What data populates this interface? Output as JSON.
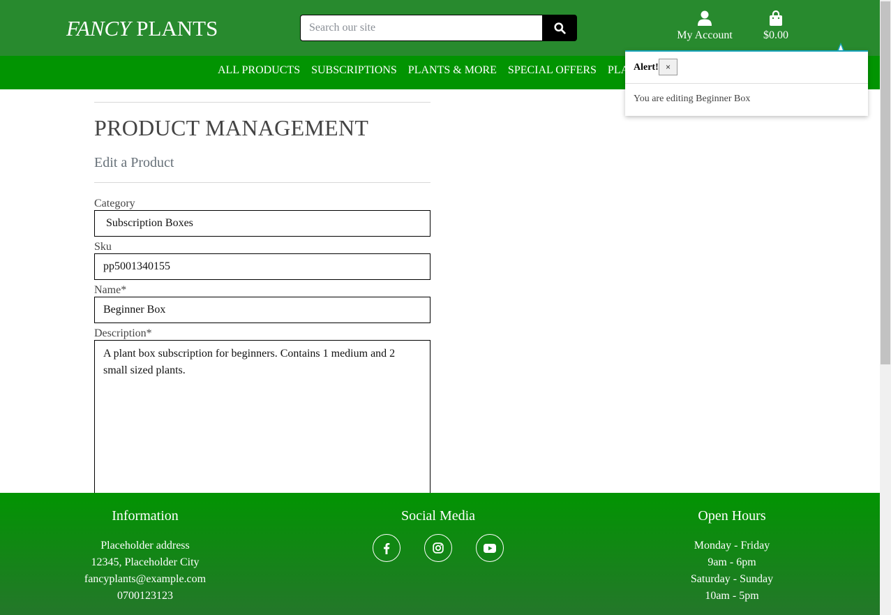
{
  "header": {
    "brand_italic": "FANCY",
    "brand_rest": "PLANTS",
    "search_placeholder": "Search our site",
    "account_label": "My Account",
    "bag_total": "$0.00"
  },
  "nav": {
    "items": [
      "ALL PRODUCTS",
      "SUBSCRIPTIONS",
      "PLANTS & MORE",
      "SPECIAL OFFERS",
      "PLA"
    ]
  },
  "main": {
    "title": "PRODUCT MANAGEMENT",
    "subtitle": "Edit a Product",
    "fields": {
      "category_label": "Category",
      "category_value": "Subscription Boxes",
      "sku_label": "Sku",
      "sku_value": "pp5001340155",
      "name_label": "Name*",
      "name_value": "Beginner Box",
      "description_label": "Description*",
      "description_value": "A plant box subscription for beginners. Contains 1 medium and 2 small sized plants."
    }
  },
  "alert": {
    "title": "Alert!",
    "close_label": "×",
    "message": "You are editing Beginner Box"
  },
  "footer": {
    "info_heading": "Information",
    "info_lines": [
      "Placeholder address",
      "12345, Placeholder City",
      "fancyplants@example.com",
      "0700123123"
    ],
    "social_heading": "Social Media",
    "hours_heading": "Open Hours",
    "hours_lines": [
      "Monday - Friday",
      "9am - 6pm",
      "Saturday - Sunday",
      "10am - 5pm"
    ]
  },
  "colors": {
    "header_green": "#288a2e",
    "nav_green": "#029402",
    "alert_accent": "#17a2b8"
  },
  "icons": [
    "search-icon",
    "user-icon",
    "shopping-bag-icon",
    "facebook-icon",
    "instagram-icon",
    "youtube-icon"
  ]
}
